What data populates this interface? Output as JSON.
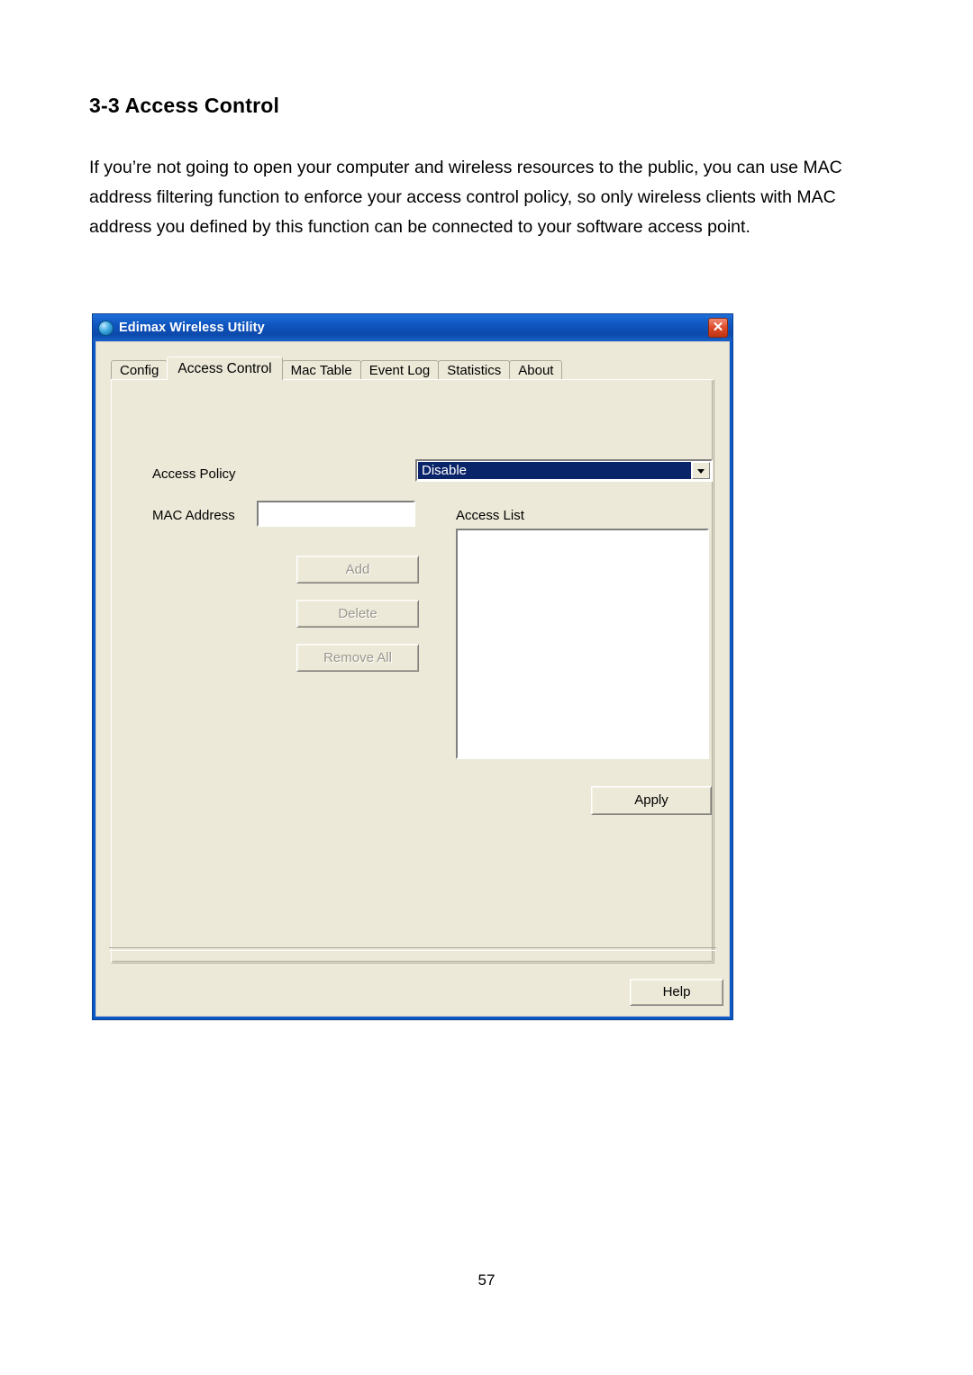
{
  "document": {
    "heading": "3-3 Access Control",
    "paragraph": "If you’re not going to open your computer and wireless resources to the public, you can use MAC address filtering function to enforce your access control policy, so only wireless clients with MAC address you defined by this function can be connected to your software access point.",
    "page_number": "57"
  },
  "window": {
    "title": "Edimax Wireless Utility",
    "close_label": "✕",
    "titlebar_color": "#0a58c8",
    "face_color": "#ece9d8",
    "tabs": [
      {
        "label": "Config",
        "active": false
      },
      {
        "label": "Access Control",
        "active": true
      },
      {
        "label": "Mac Table",
        "active": false
      },
      {
        "label": "Event Log",
        "active": false
      },
      {
        "label": "Statistics",
        "active": false
      },
      {
        "label": "About",
        "active": false
      }
    ],
    "form": {
      "access_policy_label": "Access Policy",
      "access_policy_value": "Disable",
      "access_policy_options": [
        "Disable"
      ],
      "mac_address_label": "MAC Address",
      "mac_address_value": "",
      "access_list_label": "Access List",
      "access_list_items": [],
      "buttons": {
        "add": "Add",
        "delete": "Delete",
        "remove_all": "Remove All",
        "apply": "Apply",
        "help": "Help"
      }
    }
  }
}
